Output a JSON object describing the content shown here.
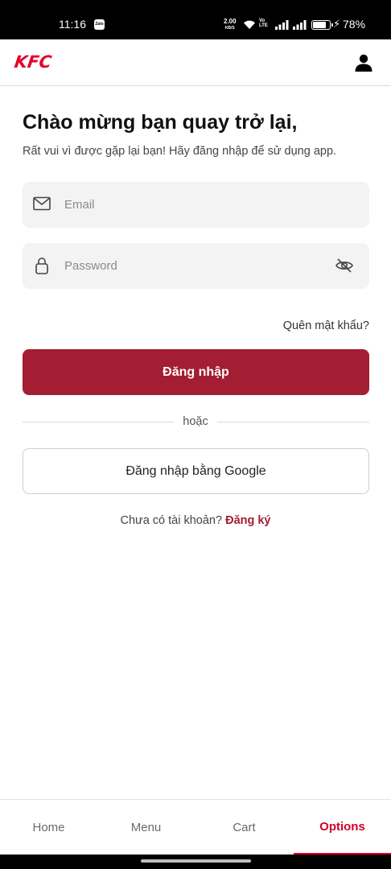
{
  "status_bar": {
    "time": "11:16",
    "zalo_label": "Zalo",
    "net_speed": "2.00",
    "net_unit": "KB/S",
    "volte_top": "Vo",
    "volte_bottom": "LTE",
    "battery_percent": "78%",
    "battery_level": 0.78,
    "icons": [
      "zalo-icon",
      "wifi-icon",
      "signal-icon",
      "battery-icon",
      "charging-bolt-icon"
    ]
  },
  "header": {
    "logo": "KFC",
    "account_icon": "user-icon",
    "colors": {
      "brand": "#e4002b"
    }
  },
  "main": {
    "title": "Chào mừng bạn quay trở lại,",
    "subtitle": "Rất vui vì được gặp lại bạn! Hãy đăng nhập để sử dụng app.",
    "email": {
      "placeholder": "Email",
      "value": "",
      "icon": "mail-icon"
    },
    "password": {
      "placeholder": "Password",
      "value": "",
      "icon": "lock-icon",
      "toggle_icon": "eye-off-icon"
    },
    "forgot_password": "Quên mật khẩu?",
    "login_button": "Đăng nhập",
    "divider_text": "hoặc",
    "google_button": "Đăng nhập bằng Google",
    "signup_prompt": "Chưa có tài khoản?",
    "signup_link": "Đăng ký",
    "colors": {
      "primary_button": "#a31d33",
      "link": "#a31d33"
    }
  },
  "bottom_nav": {
    "items": [
      {
        "label": "Home",
        "active": false
      },
      {
        "label": "Menu",
        "active": false
      },
      {
        "label": "Cart",
        "active": false
      },
      {
        "label": "Options",
        "active": true
      }
    ],
    "colors": {
      "active": "#d2002a"
    }
  }
}
